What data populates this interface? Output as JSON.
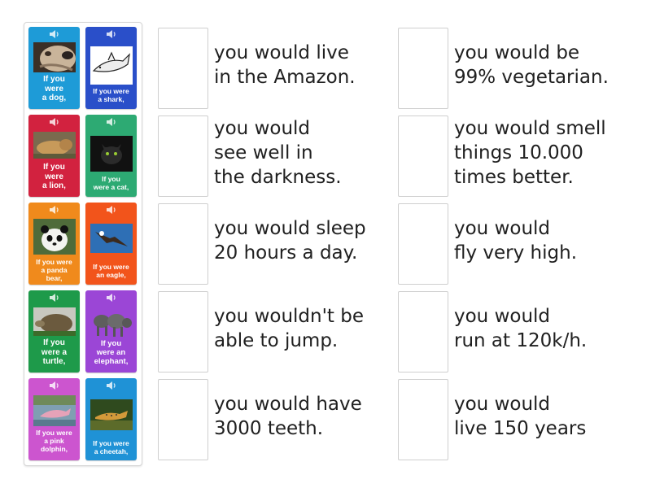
{
  "cards": [
    {
      "label": "If you\nwere\na dog,",
      "color": "#1e9bd7",
      "icon": "dog-photo"
    },
    {
      "label": "If you were\na shark,",
      "color": "#2a4fc9",
      "icon": "shark-drawing"
    },
    {
      "label": "If you\nwere\na lion,",
      "color": "#d2223f",
      "icon": "lion-photo"
    },
    {
      "label": "If you\nwere a cat,",
      "color": "#2daa73",
      "icon": "cat-photo"
    },
    {
      "label": "If you were\na panda\nbear,",
      "color": "#f08a1c",
      "icon": "panda-photo"
    },
    {
      "label": "If you were\nan eagle,",
      "color": "#f2541b",
      "icon": "eagle-photo"
    },
    {
      "label": "If you\nwere a\nturtle,",
      "color": "#1e9a4a",
      "icon": "turtle-photo"
    },
    {
      "label": "If you\nwere an\nelephant,",
      "color": "#9b46d6",
      "icon": "elephant-photo"
    },
    {
      "label": "If you were\na pink\ndolphin,",
      "color": "#cc55cf",
      "icon": "dolphin-photo"
    },
    {
      "label": "If you were\na cheetah,",
      "color": "#1f92d6",
      "icon": "cheetah-photo"
    }
  ],
  "targets": [
    "you would live\nin the Amazon.",
    "you would be\n99% vegetarian.",
    "you would\nsee well in\nthe darkness.",
    "you would smell\nthings 10.000\ntimes better.",
    "you would sleep\n20 hours a day.",
    "you would\nfly very high.",
    "you wouldn't be\nable to jump.",
    "you would\nrun at 120k/h.",
    "you would have\n3000 teeth.",
    "you would\nlive 150 years"
  ]
}
